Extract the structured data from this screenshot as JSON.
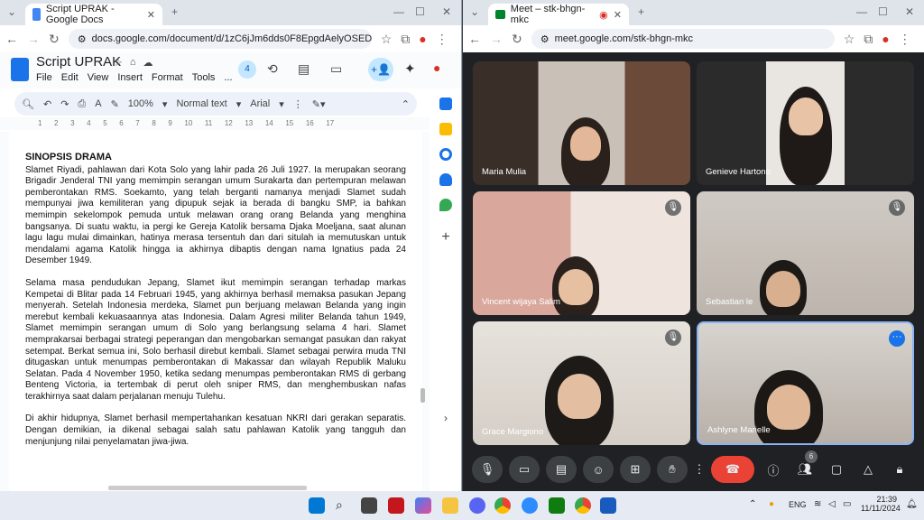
{
  "left_window": {
    "tab_title": "Script UPRAK - Google Docs",
    "url": "docs.google.com/document/d/1zC6jJm6dds0F8EpgdAelyOSEDowj...",
    "doc_title": "Script UPRAK",
    "menus": [
      "File",
      "Edit",
      "View",
      "Insert",
      "Format",
      "Tools",
      "..."
    ],
    "comment_count": "4",
    "toolbar": {
      "zoom": "100%",
      "style": "Normal text",
      "font": "Arial"
    },
    "ruler": [
      "1",
      "2",
      "3",
      "4",
      "5",
      "6",
      "7",
      "8",
      "9",
      "10",
      "11",
      "12",
      "13",
      "14",
      "15",
      "16",
      "17"
    ],
    "heading": "SINOPSIS DRAMA",
    "paragraphs": [
      "Slamet Riyadi, pahlawan dari Kota Solo yang lahir pada 26 Juli 1927. Ia merupakan seorang Brigadir Jenderal TNI yang memimpin serangan umum Surakarta dan pertempuran melawan pemberontakan RMS. Soekamto, yang telah berganti namanya menjadi Slamet sudah mempunyai jiwa kemiliteran yang dipupuk sejak ia berada di bangku SMP, ia bahkan memimpin sekelompok pemuda untuk melawan orang orang Belanda yang menghina bangsanya. Di suatu waktu, ia pergi ke Gereja Katolik bersama Djaka Moeljana, saat alunan lagu lagu mulai dimainkan, hatinya merasa tersentuh dan dari situlah ia memutuskan untuk mendalami agama Katolik hingga ia akhirnya dibaptis dengan nama Ignatius pada 24 Desember 1949.",
      "Selama masa pendudukan Jepang, Slamet ikut memimpin serangan terhadap markas Kempetai di Blitar pada 14 Februari 1945, yang akhirnya berhasil memaksa pasukan Jepang menyerah. Setelah Indonesia merdeka, Slamet pun berjuang melawan Belanda yang ingin merebut kembali kekuasaannya atas Indonesia. Dalam Agresi militer Belanda tahun 1949, Slamet memimpin serangan umum di Solo yang berlangsung selama 4 hari. Slamet memprakarsai berbagai strategi peperangan dan mengobarkan semangat pasukan dan rakyat setempat. Berkat semua ini, Solo berhasil direbut kembali. Slamet sebagai perwira muda TNI ditugaskan untuk menumpas pemberontakan di Makassar dan wilayah Republik Maluku Selatan. Pada 4 November 1950, ketika sedang menumpas pemberontakan RMS di gerbang Benteng Victoria, ia tertembak di perut oleh sniper RMS, dan menghembuskan nafas terakhirnya saat dalam perjalanan menuju Tulehu.",
      "Di akhir hidupnya, Slamet berhasil mempertahankan kesatuan NKRI dari gerakan separatis. Dengan demikian, ia dikenal sebagai salah satu pahlawan Katolik yang tangguh dan menjunjung nilai penyelamatan jiwa-jiwa."
    ]
  },
  "right_window": {
    "tab_title": "Meet – stk-bhgn-mkc",
    "url": "meet.google.com/stk-bhgn-mkc",
    "participants": [
      {
        "name": "Maria Mulia",
        "muted": false
      },
      {
        "name": "Genieve Hartono",
        "muted": false
      },
      {
        "name": "Vincent wijaya Salim",
        "muted": true
      },
      {
        "name": "Sebastian le",
        "muted": true
      },
      {
        "name": "Grace Margiono",
        "muted": true
      },
      {
        "name": "Ashlyne Marielle",
        "muted": false
      }
    ],
    "people_count": "6"
  },
  "taskbar": {
    "lang": "ENG",
    "time": "21:39",
    "date": "11/11/2024"
  },
  "colors": {
    "docs_blue": "#1a73e8",
    "meet_bg": "#202124",
    "end_call": "#ea4335"
  }
}
